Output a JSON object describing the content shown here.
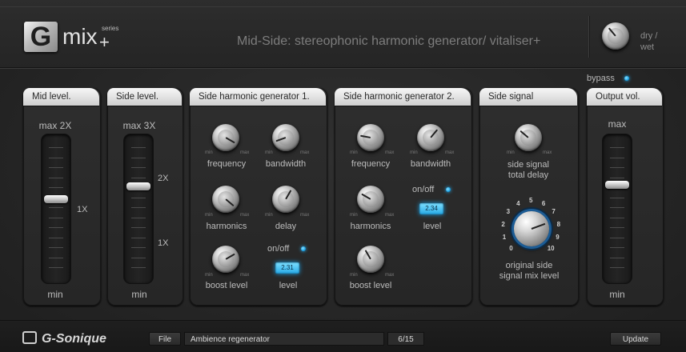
{
  "app": {
    "logo_letter": "G",
    "logo_name": "mix",
    "logo_plus": "+",
    "logo_series": "series",
    "subtitle": "Mid-Side: stereophonic harmonic generator/ vitaliser+",
    "drywet_label_1": "dry /",
    "drywet_label_2": "wet",
    "bypass_label": "bypass"
  },
  "panels": {
    "mid_level": {
      "title": "Mid level.",
      "max_label": "max 2X",
      "mark_label": "1X",
      "min_label": "min",
      "value_x": 1.0
    },
    "side_level": {
      "title": "Side level.",
      "max_label": "max 3X",
      "mark_2x": "2X",
      "mark_1x": "1X",
      "min_label": "min",
      "value_x": 2.0
    },
    "shg1": {
      "title": "Side harmonic generator 1.",
      "frequency": "frequency",
      "bandwidth": "bandwidth",
      "harmonics": "harmonics",
      "delay": "delay",
      "boost_level": "boost level",
      "onoff": "on/off",
      "level": "level",
      "level_value": "2.31"
    },
    "shg2": {
      "title": "Side harmonic generator 2.",
      "frequency": "frequency",
      "bandwidth": "bandwidth",
      "harmonics": "harmonics",
      "onoff": "on/off",
      "level": "level",
      "level_value": "2.34",
      "boost_level": "boost level"
    },
    "side_signal": {
      "title": "Side signal",
      "delay_label_1": "side signal",
      "delay_label_2": "total delay",
      "mix_label_1": "original side",
      "mix_label_2": "signal mix level",
      "scale": [
        "0",
        "1",
        "2",
        "3",
        "4",
        "5",
        "6",
        "7",
        "8",
        "9",
        "10"
      ]
    },
    "output_vol": {
      "title": "Output vol.",
      "max_label": "max",
      "min_label": "min"
    }
  },
  "knob_range": {
    "min": "min",
    "max": "max"
  },
  "footer": {
    "brand": "G-Sonique",
    "file_button": "File",
    "preset_name": "Ambience regenerator",
    "preset_counter": "6/15",
    "update_button": "Update"
  }
}
